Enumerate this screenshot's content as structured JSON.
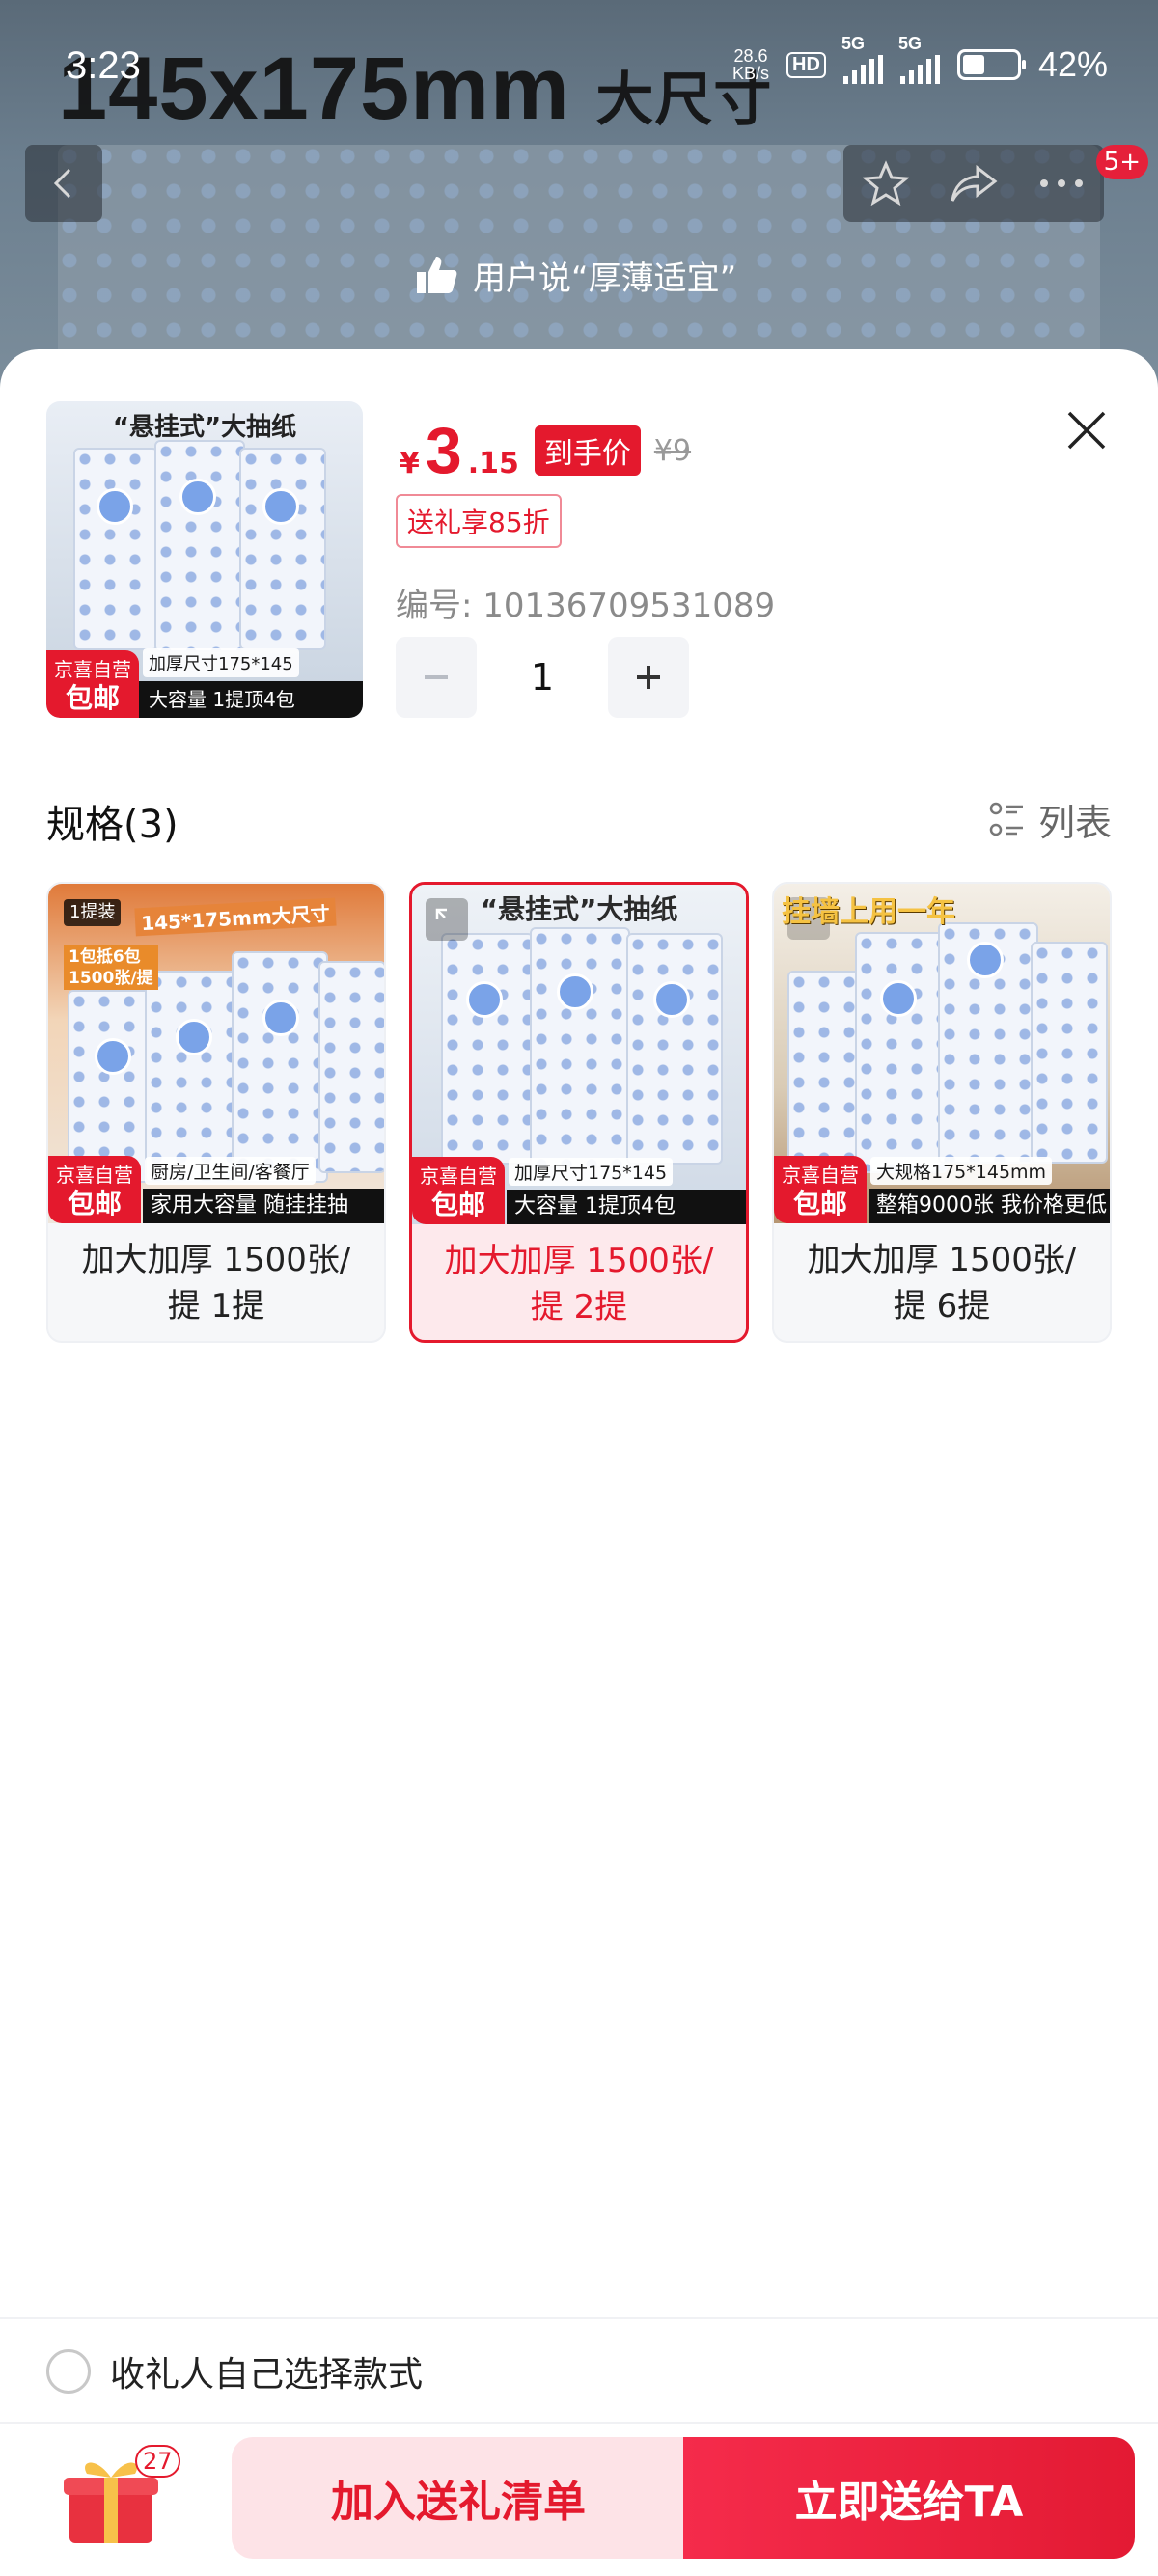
{
  "status_bar": {
    "time": "3:23",
    "net_speed": "28.6",
    "net_unit": "KB/s",
    "hd": "HD",
    "sim1": "5G",
    "sim2": "5G",
    "battery": "42%"
  },
  "backdrop": {
    "title": "145x175mm",
    "title_suffix": "大尺寸",
    "user_say": "用户说“厚薄适宜”",
    "notification_badge": "5+"
  },
  "product": {
    "thumb_title": "“悬挂式”大抽纸",
    "thumb_caption_1": "加厚尺寸175*145",
    "thumb_caption_2": "大容量 1提顶4包",
    "jd_badge_top": "京喜自营",
    "jd_badge_bottom": "包邮",
    "price_currency": "¥",
    "price_int": "3",
    "price_dec": ".15",
    "price_tag": "到手价",
    "original_price": "¥9",
    "gift_discount": "送礼享85折",
    "sku_code": "编号: 10136709531089",
    "quantity": "1"
  },
  "spec": {
    "title": "规格(3)",
    "list_toggle": "列表",
    "options": [
      {
        "label": "加大加厚 1500张/\n提 1提",
        "selected": false,
        "tl_1": "1提装",
        "tl_2": "1包抵6包\n1500张/提",
        "head": "145*175mm大尺寸",
        "cap_top": "厨房/卫生间/客餐厅",
        "cap": "家用大容量 随挂挂抽"
      },
      {
        "label": "加大加厚 1500张/\n提 2提",
        "selected": true,
        "banner": "“悬挂式”大抽纸",
        "cap_top": "加厚尺寸175*145",
        "cap": "大容量 1提顶4包"
      },
      {
        "label": "加大加厚 1500张/\n提 6提",
        "selected": false,
        "banner": "挂墙上用一年",
        "cap_top": "大规格175*145mm",
        "cap": "整箱9000张 我价格更低"
      }
    ]
  },
  "self_select": "收礼人自己选择款式",
  "bottom_bar": {
    "gift_count": "27",
    "add_to_list": "加入送礼清单",
    "send_now": "立即送给TA"
  },
  "colors": {
    "accent": "#e4192d",
    "accent_light": "#fde3e7"
  }
}
